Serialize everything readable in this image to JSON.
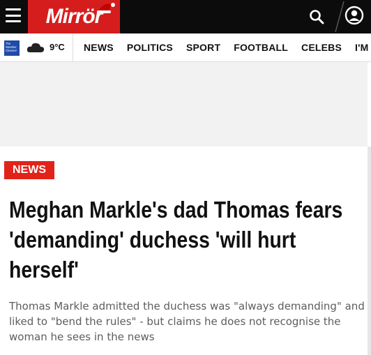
{
  "header": {
    "menu_icon": "hamburger-menu-icon",
    "logo_text": "Mirrör",
    "logo_color": "#d51d1d",
    "search_icon": "search-icon",
    "account_icon": "user-account-icon"
  },
  "weather": {
    "provider_logo_text": "The Weather Channel",
    "icon": "cloud-icon",
    "temperature": "9°C"
  },
  "nav": {
    "items": [
      "NEWS",
      "POLITICS",
      "SPORT",
      "FOOTBALL",
      "CELEBS",
      "I'M A CELEBRITY"
    ]
  },
  "article": {
    "section_badge": "NEWS",
    "badge_color": "#e2231a",
    "headline": "Meghan Markle's dad Thomas fears 'demanding' duchess 'will hurt herself'",
    "standfirst": "Thomas Markle admitted the duchess was \"always demanding\" and liked to \"bend the rules\" - but claims he does not recognise the woman he sees in the news"
  }
}
